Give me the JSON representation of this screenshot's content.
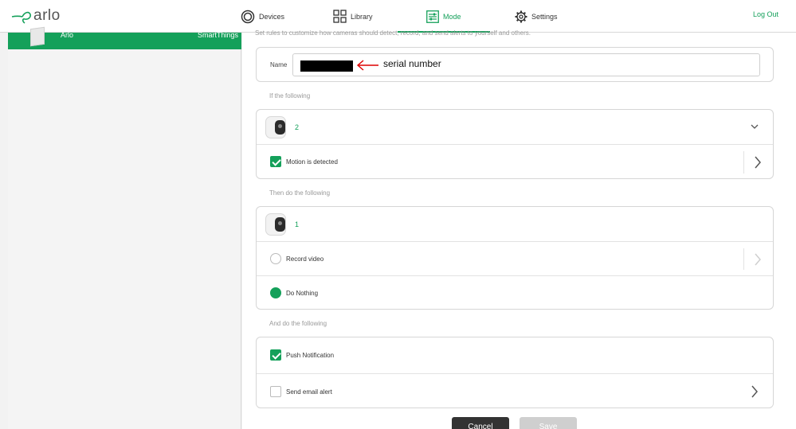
{
  "header": {
    "logo_text": "arlo",
    "nav": [
      {
        "label": "Devices",
        "icon": "devices-icon"
      },
      {
        "label": "Library",
        "icon": "library-grid-icon"
      },
      {
        "label": "Mode",
        "icon": "mode-sliders-icon",
        "active": true
      },
      {
        "label": "Settings",
        "icon": "gear-icon"
      }
    ],
    "logout_label": "Log Out"
  },
  "sidebar": {
    "active_item": {
      "label": "Arlo",
      "sub": "SmartThings"
    }
  },
  "main": {
    "intro_text": "Set rules to customize how cameras should detect, record, and send alerts to yourself and others.",
    "name_label": "Name",
    "annotation_text": "serial number",
    "if_label": "If the following",
    "trigger_camera_count": "2",
    "trigger_action": "Motion is detected",
    "then_label": "Then do the following",
    "action_camera_count": "1",
    "record_label": "Record video",
    "nothing_label": "Do Nothing",
    "and_label": "And do the following",
    "push_label": "Push Notification",
    "email_label": "Send email alert",
    "cancel_label": "Cancel",
    "save_label": "Save"
  },
  "colors": {
    "accent": "#14a05a"
  }
}
